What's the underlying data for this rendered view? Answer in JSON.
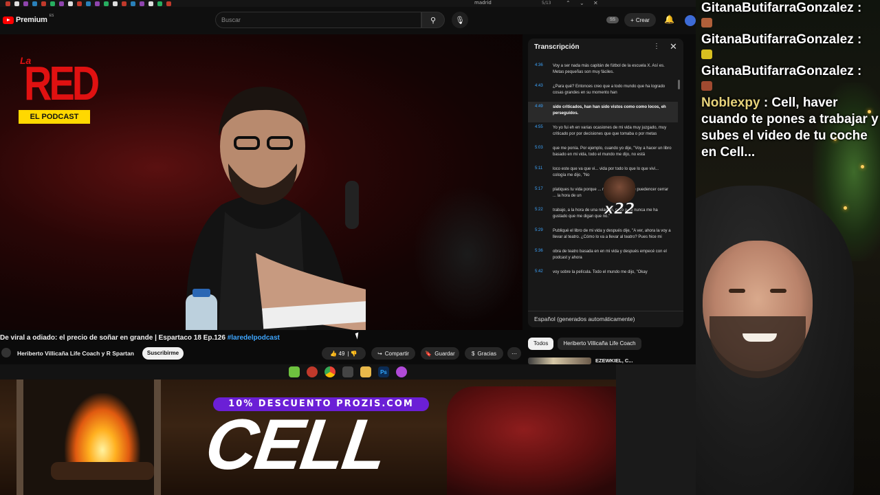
{
  "browser": {
    "tab_search": "madrid",
    "tab_count": "5/13"
  },
  "header": {
    "logo_text": "Premium",
    "logo_region": "ES",
    "search_placeholder": "Buscar",
    "ss_badge": "SS",
    "create_label": "Crear",
    "icons": [
      "youtube-logo-icon",
      "search-icon",
      "mic-icon",
      "plus-icon",
      "bell-icon"
    ]
  },
  "video": {
    "show_logo_small": "La",
    "show_logo_big": "RED",
    "show_logo_sub": "EL PODCAST",
    "title": "De viral a odiado: el precio de soñar en grande | Espartaco 18 Ep.126 ",
    "hashtag": "#laredelpodcast",
    "channel": "Heriberto Villicaña Life Coach y R Spartan",
    "subscribe": "Suscribirme",
    "likes": "49",
    "share": "Compartir",
    "save": "Guardar",
    "thanks": "Gracias"
  },
  "transcript": {
    "title": "Transcripción",
    "language": "Español (generados automáticamente)",
    "emote_label": "x22",
    "items": [
      {
        "time": "4:36",
        "text": "Voy a ser nada más capitán de fútbol de la escuela X. Así es. Metas pequeñas son muy fáciles."
      },
      {
        "time": "4:43",
        "text": "¿Para qué? Entonces creo que a todo mundo que ha logrado cosas grandes en su momento han"
      },
      {
        "time": "4:49",
        "text": "sido criticados, han han sido vistos como como locos, eh perseguidos."
      },
      {
        "time": "4:55",
        "text": "Yo yo fui eh en varias ocasiones de mi vida muy juzgado, muy criticado por por decisiones que que tomaba o por metas"
      },
      {
        "time": "5:03",
        "text": "que me ponía. Por ejemplo, cuando yo dije, \"Voy a hacer un libro basado en mi vida, todo el mundo me dijo, no está"
      },
      {
        "time": "5:11",
        "text": "loco este que va que vi... vida por todo lo que lo que vivi... cología me dijo, \"No"
      },
      {
        "time": "5:17",
        "text": "platiques tu vida porque ... muy fuertes. Se te puedencer cerrar ... la hora de un"
      },
      {
        "time": "5:22",
        "text": "trabajo, a la hora de una relación, pero a mí nunca me ha gustado que me digan que no.\""
      },
      {
        "time": "5:29",
        "text": "Publiqué el libro de mi vida y después dije, \"A ver, ahora la voy a llevar al teatro. ¿Cómo lo va a llevar al teatro? Pues hice mi"
      },
      {
        "time": "5:36",
        "text": "obra de teatro basada en en mi vida y después empecé con el podcast y ahora"
      },
      {
        "time": "5:42",
        "text": "voy sobre la película. Todo el mundo me dijo, \"Okay"
      }
    ]
  },
  "chips": {
    "all": "Todos",
    "channel": "Heriberto Villicaña Life Coach",
    "rec_title": "EZEWKIEL, C..."
  },
  "overlay": {
    "promo_banner": "10% DESCUENTO PROZIS.COM",
    "promo_big": "CELL"
  },
  "chat": [
    {
      "user": "GitanaButifarraGonzalez",
      "text": ":",
      "emote": "#b0603a"
    },
    {
      "user": "GitanaButifarraGonzalez",
      "text": ":",
      "emote": "#d8c020"
    },
    {
      "user": "GitanaButifarraGonzalez",
      "text": ":",
      "emote": "#a04a30"
    },
    {
      "user": "Noblexpy",
      "text": ": Cell, haver cuando te pones a trabajar y subes el video de tu coche en Cell..."
    }
  ],
  "colors": {
    "youtube_red": "#ff0000",
    "link_blue": "#3ea6ff",
    "promo_purple": "#6b1fd6",
    "logo_yellow": "#ffd800"
  }
}
